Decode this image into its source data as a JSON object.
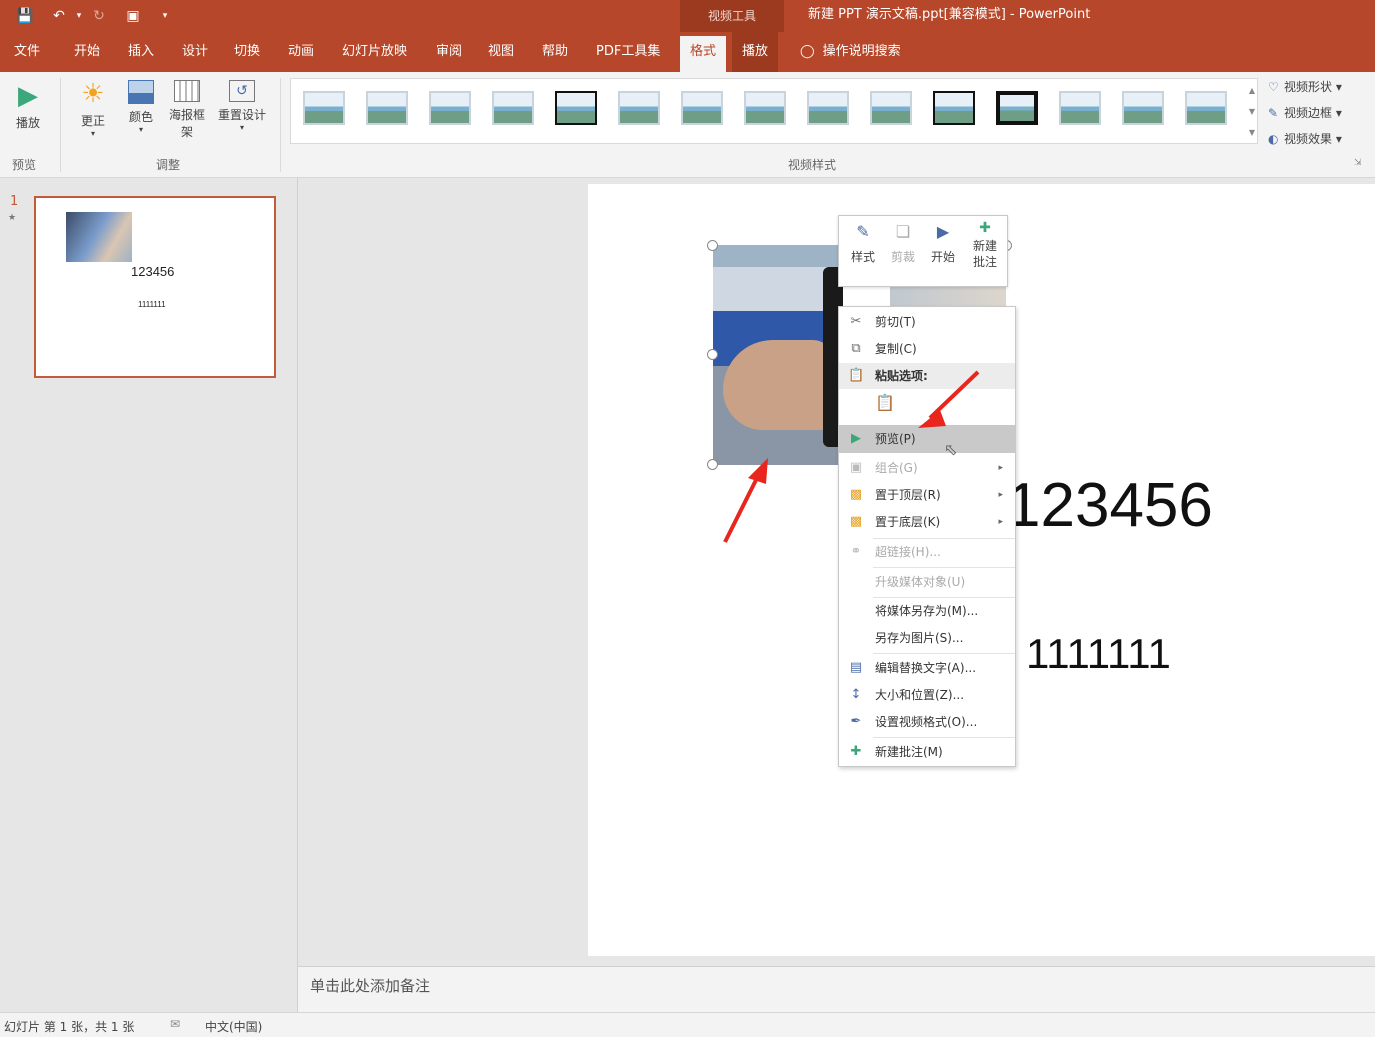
{
  "window": {
    "context_group": "视频工具",
    "title": "新建 PPT 演示文稿.ppt[兼容模式] - PowerPoint"
  },
  "tabs": [
    {
      "label": "文件"
    },
    {
      "label": "开始"
    },
    {
      "label": "插入"
    },
    {
      "label": "设计"
    },
    {
      "label": "切换"
    },
    {
      "label": "动画"
    },
    {
      "label": "幻灯片放映"
    },
    {
      "label": "审阅"
    },
    {
      "label": "视图"
    },
    {
      "label": "帮助"
    },
    {
      "label": "PDF工具集"
    },
    {
      "label": "格式"
    },
    {
      "label": "播放"
    }
  ],
  "search": {
    "label": "操作说明搜索"
  },
  "ribbon": {
    "play_label": "播放",
    "preview_group": "预览",
    "correct_label": "更正",
    "color_label": "颜色",
    "poster_label": "海报框架",
    "reset_label": "重置设计",
    "adjust_group": "调整",
    "styles_group": "视频样式",
    "shape_label": "视频形状",
    "border_label": "视频边框",
    "effects_label": "视频效果"
  },
  "slide_panel": {
    "number": "1",
    "star": "★",
    "thumb_title": "123456",
    "thumb_sub": "1111111"
  },
  "slide": {
    "title": "123456",
    "subtitle": "1111111"
  },
  "mini_toolbar": {
    "style": "样式",
    "crop": "剪裁",
    "start": "开始",
    "new_comment": "新建批注"
  },
  "context_menu": {
    "cut": "剪切(T)",
    "copy": "复制(C)",
    "paste_options": "粘贴选项:",
    "preview": "预览(P)",
    "group": "组合(G)",
    "bring_front": "置于顶层(R)",
    "send_back": "置于底层(K)",
    "hyperlink": "超链接(H)...",
    "upgrade": "升级媒体对象(U)",
    "save_media": "将媒体另存为(M)...",
    "save_picture": "另存为图片(S)...",
    "alt_text": "编辑替换文字(A)...",
    "size_pos": "大小和位置(Z)...",
    "format_video": "设置视频格式(O)...",
    "new_comment": "新建批注(M)"
  },
  "notes": {
    "placeholder": "单击此处添加备注"
  },
  "status": {
    "slide_info": "幻灯片 第 1 张，共 1 张",
    "language": "中文(中国)"
  },
  "colors": {
    "accent": "#b7472a",
    "highlight": "#c9c9c9",
    "arrow": "#e8261d"
  }
}
